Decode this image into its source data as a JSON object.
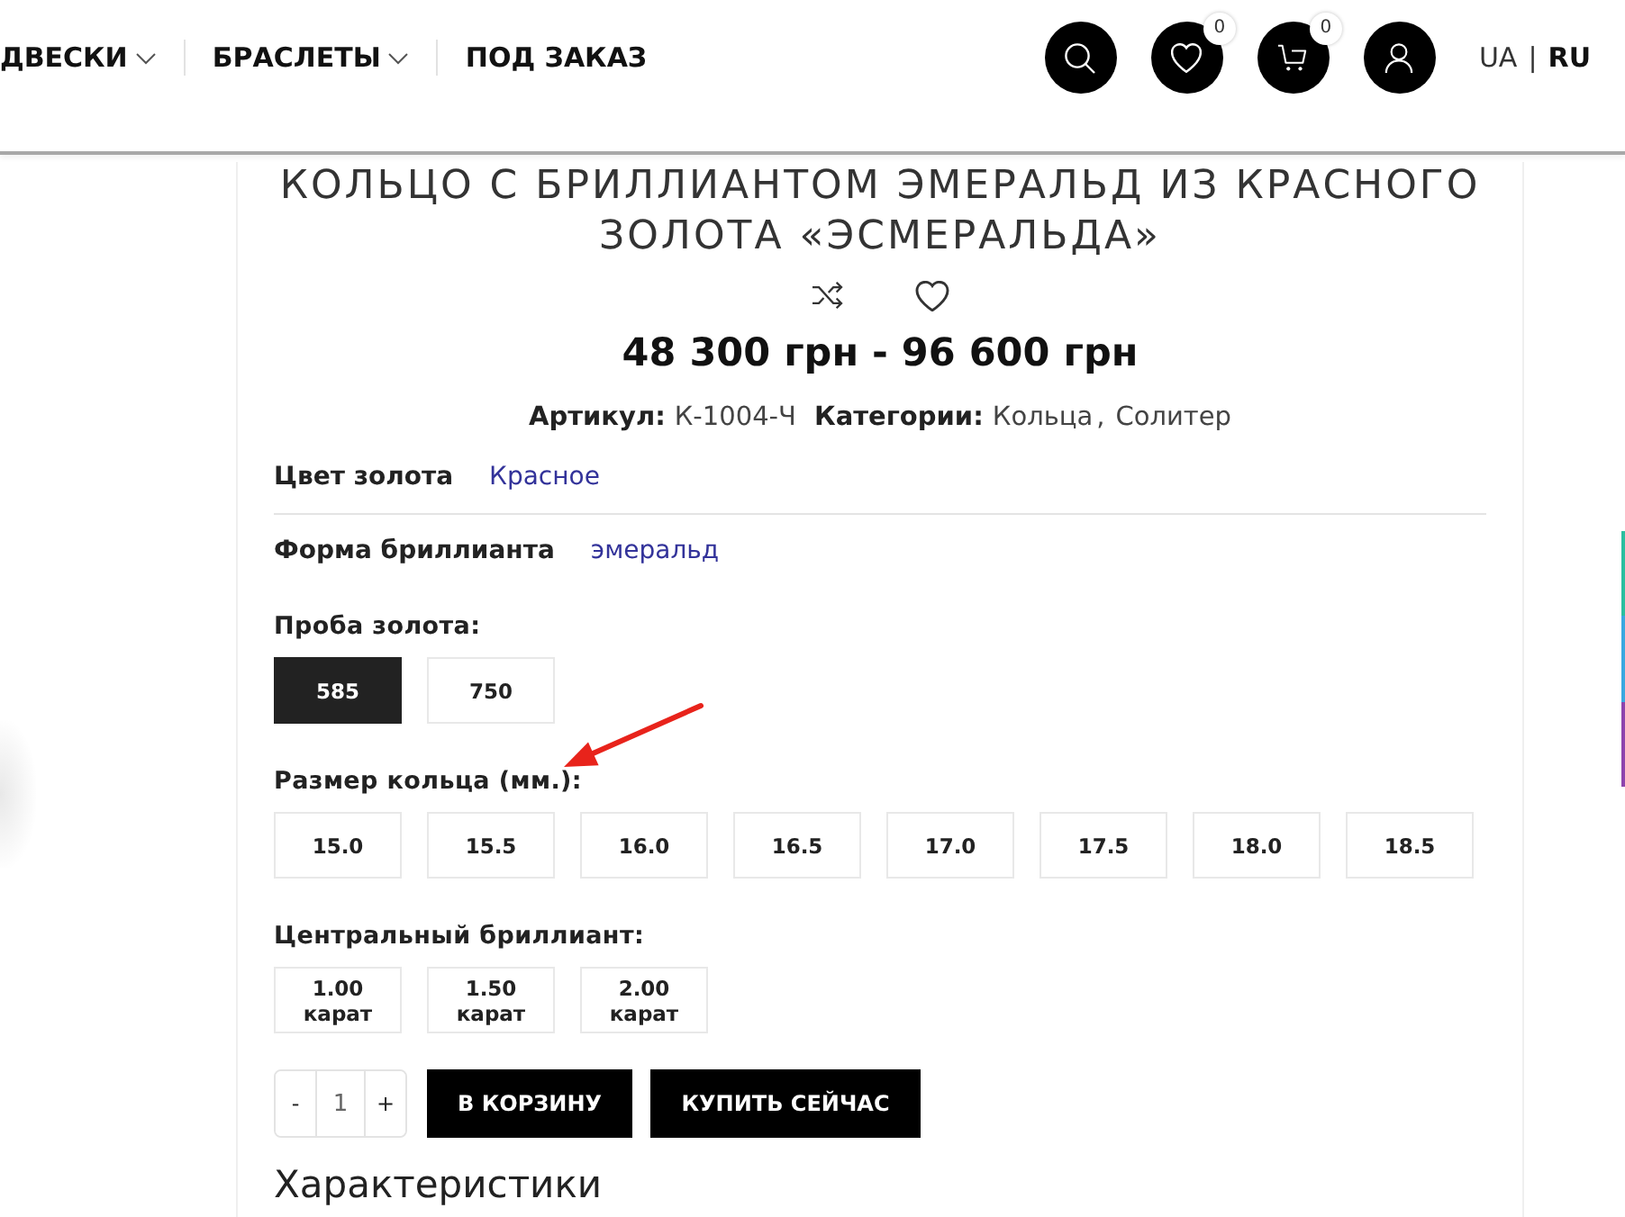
{
  "header": {
    "nav": [
      {
        "label": "ДВЕСКИ",
        "dropdown": true
      },
      {
        "label": "БРАСЛЕТЫ",
        "dropdown": true
      },
      {
        "label": "ПОД ЗАКАЗ",
        "dropdown": false
      }
    ],
    "wishlist_count": "0",
    "cart_count": "0",
    "languages": [
      {
        "label": "UA",
        "selected": false
      },
      {
        "label": "RU",
        "selected": true
      }
    ],
    "language_separator": "|"
  },
  "product": {
    "title": "КОЛЬЦО С БРИЛЛИАНТОМ ЭМЕРАЛЬД ИЗ КРАСНОГО ЗОЛОТА «ЭСМЕРАЛЬДА»",
    "price": "48 300 грн - 96 600 грн",
    "meta": {
      "sku_label": "Артикул:",
      "sku": "К-1004-Ч",
      "categories_label": "Категории:",
      "categories": [
        "Кольца",
        "Солитер"
      ],
      "category_separator": ","
    },
    "attributes": [
      {
        "label": "Цвет золота",
        "value": "Красное"
      },
      {
        "label": "Форма бриллианта",
        "value": "эмеральд"
      }
    ],
    "options": [
      {
        "label": "Проба золота:",
        "choices": [
          {
            "label": "585",
            "selected": true
          },
          {
            "label": "750",
            "selected": false
          }
        ]
      },
      {
        "label": "Размер кольца (мм.):",
        "choices": [
          {
            "label": "15.0",
            "selected": false
          },
          {
            "label": "15.5",
            "selected": false
          },
          {
            "label": "16.0",
            "selected": false
          },
          {
            "label": "16.5",
            "selected": false
          },
          {
            "label": "17.0",
            "selected": false
          },
          {
            "label": "17.5",
            "selected": false
          },
          {
            "label": "18.0",
            "selected": false
          },
          {
            "label": "18.5",
            "selected": false
          }
        ]
      },
      {
        "label": "Центральный бриллиант:",
        "choices": [
          {
            "label": "1.00 карат",
            "selected": false
          },
          {
            "label": "1.50 карат",
            "selected": false
          },
          {
            "label": "2.00 карат",
            "selected": false
          }
        ]
      }
    ],
    "quantity": {
      "minus": "-",
      "value": "1",
      "plus": "+"
    },
    "buttons": [
      "В КОРЗИНУ",
      "КУПИТЬ СЕЙЧАС"
    ],
    "section_heading": "Характеристики"
  }
}
